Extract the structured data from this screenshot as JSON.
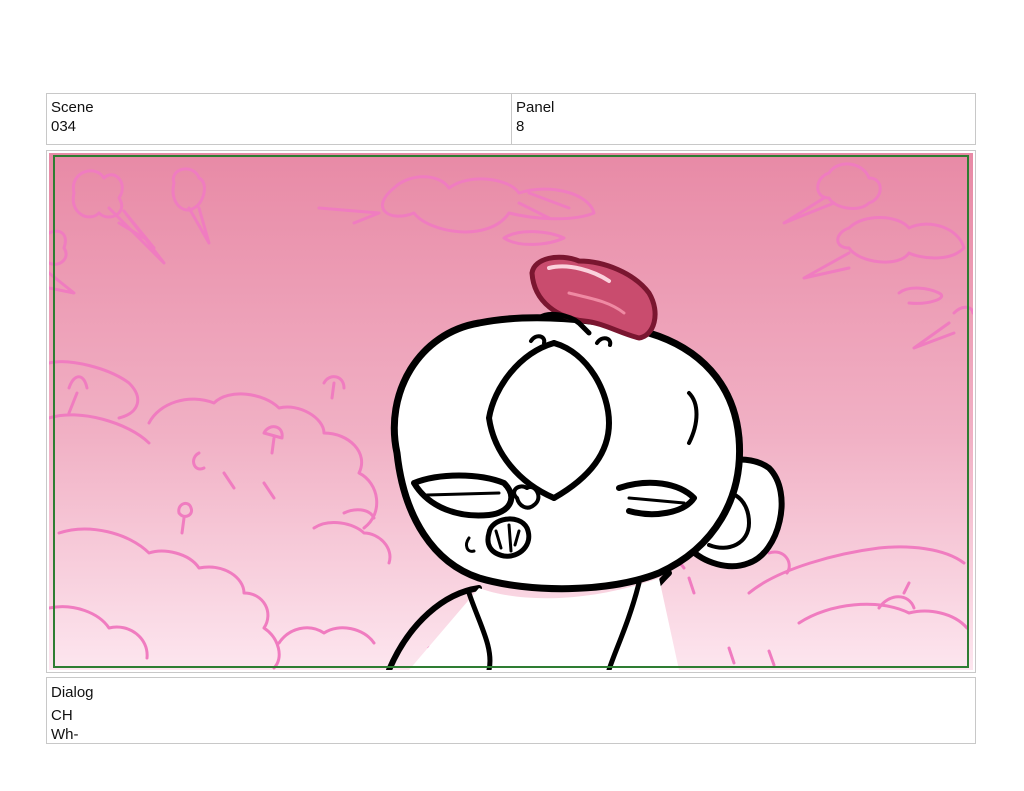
{
  "header": {
    "scene_label": "Scene",
    "scene_value": "034",
    "panel_label": "Panel",
    "panel_value": "8"
  },
  "frame": {
    "sky_top_color": "#e88aa6",
    "sky_bottom_color": "#fde6ef",
    "sketch_color": "#f07cc0",
    "safe_border_color": "#2e7d32"
  },
  "dialog": {
    "label": "Dialog",
    "character": "CH",
    "line": "Wh-"
  }
}
